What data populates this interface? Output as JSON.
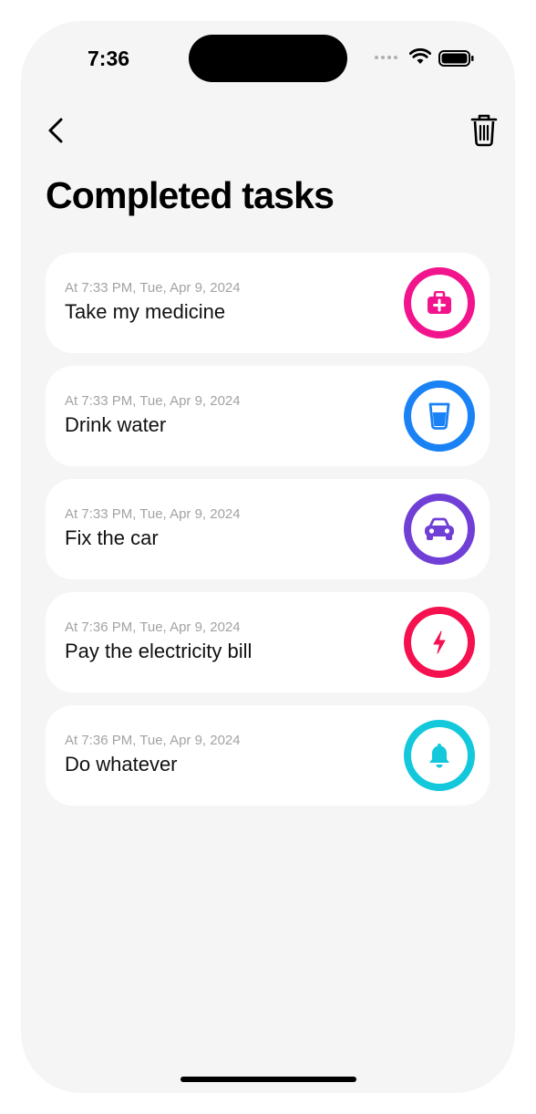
{
  "status_bar": {
    "time": "7:36"
  },
  "header": {
    "title": "Completed tasks"
  },
  "tasks": [
    {
      "time": "At 7:33 PM, Tue, Apr 9, 2024",
      "title": "Take my medicine",
      "icon": "medical-kit-icon",
      "color": "#f2148c"
    },
    {
      "time": "At 7:33 PM, Tue, Apr 9, 2024",
      "title": "Drink water",
      "icon": "water-glass-icon",
      "color": "#1a82f5"
    },
    {
      "time": "At 7:33 PM, Tue, Apr 9, 2024",
      "title": "Fix the car",
      "icon": "car-icon",
      "color": "#7040d6"
    },
    {
      "time": "At 7:36 PM, Tue, Apr 9, 2024",
      "title": "Pay the electricity bill",
      "icon": "lightning-bolt-icon",
      "color": "#f5104f"
    },
    {
      "time": "At 7:36 PM, Tue, Apr 9, 2024",
      "title": "Do whatever",
      "icon": "bell-icon",
      "color": "#14c8dc"
    }
  ]
}
